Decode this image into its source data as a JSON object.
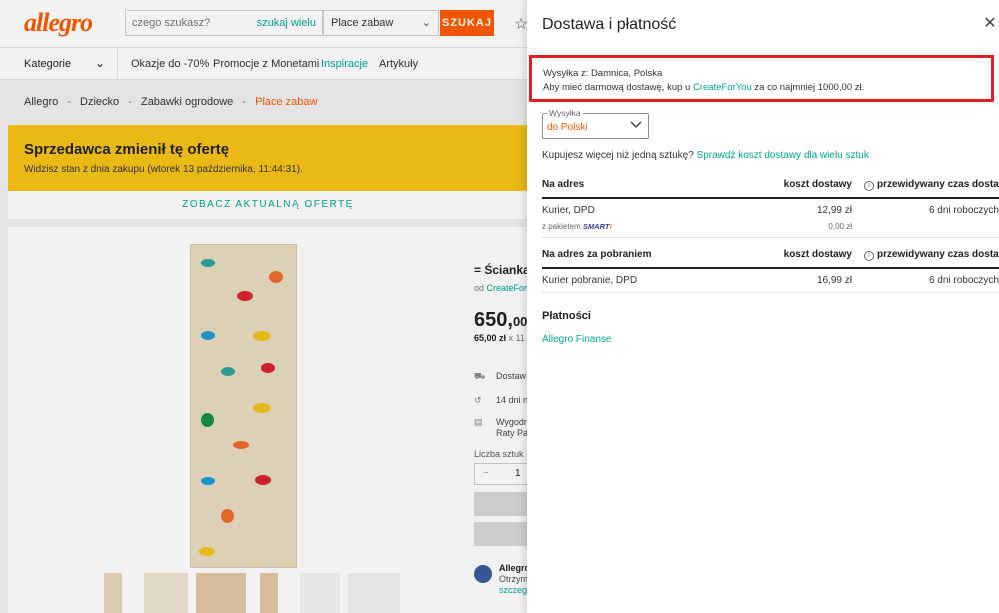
{
  "header": {
    "logo": "allegro",
    "search_placeholder": "czego szukasz?",
    "search_many": "szukaj wielu",
    "category": "Place zabaw",
    "search_button": "SZUKAJ"
  },
  "nav": {
    "categories": "Kategorie",
    "links": [
      "Okazje do -70%",
      "Promocje z Monetami",
      "Inspiracje",
      "Artykuły"
    ]
  },
  "breadcrumb": [
    "Allegro",
    "Dziecko",
    "Zabawki ogrodowe",
    "Place zabaw"
  ],
  "banner": {
    "title": "Sprzedawca zmienił tę ofertę",
    "subtitle": "Widzisz stan z dnia zakupu (wtorek 13 października, 11:44:31).",
    "see_offer": "ZOBACZ AKTUALNĄ OFERTĘ"
  },
  "product": {
    "title": "= Ścianka w",
    "seller_prefix": "od",
    "seller": "CreateForYo",
    "price_main": "650,",
    "price_cents": "00",
    "unit_price": "65,00 zł",
    "unit_suffix": "x 11",
    "info_rows": [
      "Dostaw",
      "14 dni n",
      "Wygodn",
      "Raty Pay"
    ],
    "qty_label": "Liczba sztuk",
    "qty_minus": "−",
    "qty_value": "1",
    "promo_title": "Allegro",
    "promo_line2": "Otrzym",
    "promo_line3": "szczegó"
  },
  "panel": {
    "title": "Dostawa i płatność",
    "close_icon": "close-icon",
    "ship_from": "Wysyłka z: Damnica, Polska",
    "free_prefix": "Aby mieć darmową dostawę, kup u",
    "free_seller": "CreateForYou",
    "free_suffix": "za co najmniej 1000,00 zł.",
    "country_legend": "Wysyłka",
    "country_value": "do Polski",
    "more_prefix": "Kupujesz więcej niż jedną sztukę?",
    "more_link": "Sprawdź koszt dostawy dla wielu sztuk",
    "table1": {
      "headers": [
        "Na adres",
        "koszt dostawy",
        "przewidywany czas dostawy"
      ],
      "rows": [
        {
          "method": "Kurier, DPD",
          "cost": "12,99 zł",
          "time": "6 dni roboczych"
        }
      ],
      "smart_prefix": "z pakietem",
      "smart_badge": "SMART",
      "smart_cost": "0,00 zł"
    },
    "table2": {
      "headers": [
        "Na adres za pobraniem",
        "koszt dostawy",
        "przewidywany czas dostawy"
      ],
      "rows": [
        {
          "method": "Kurier pobranie, DPD",
          "cost": "16,99 zł",
          "time": "6 dni roboczych"
        }
      ]
    },
    "payments_title": "Płatności",
    "payments_link": "Allegro Finanse"
  },
  "colors": {
    "accent": "#ff5a00",
    "link": "#00a790",
    "banner": "#f8c315",
    "highlight": "#e31e24"
  }
}
